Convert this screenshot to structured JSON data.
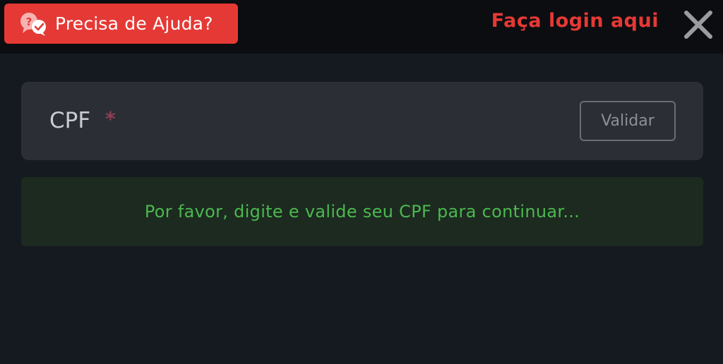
{
  "header": {
    "help_button_label": "Precisa de Ajuda?",
    "help_icon": "chat-question-icon",
    "login_link_label": "Faça login aqui",
    "close_icon": "close-icon"
  },
  "form": {
    "cpf_label": "CPF",
    "required_mark": "*",
    "cpf_value": "",
    "validate_button_label": "Validar"
  },
  "message": {
    "text": "Por favor, digite e valide seu CPF para continuar..."
  },
  "colors": {
    "accent_red": "#e53935",
    "background": "#151920",
    "topbar": "#0b0d10",
    "panel": "#2b2e35",
    "info_panel": "#1c2a20",
    "info_text": "#4cb84f"
  }
}
